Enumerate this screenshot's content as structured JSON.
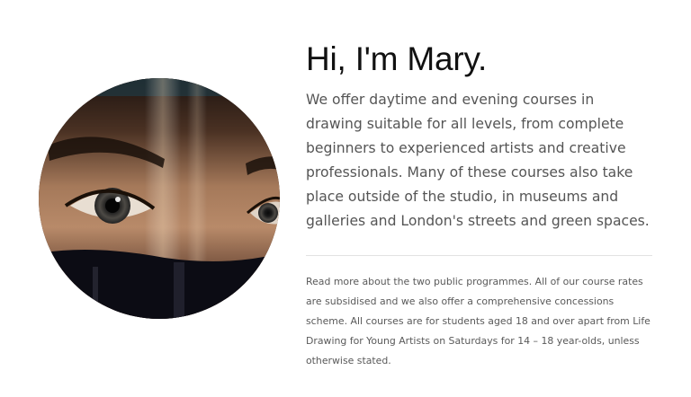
{
  "about": {
    "heading": "Hi, I'm Mary.",
    "lead": "We offer daytime and evening courses in drawing suitable for all levels, from complete beginners to experienced artists and creative professionals. Many of these courses also take place outside of the studio, in museums and galleries and London's streets and green spaces.",
    "note": "Read more about the two public programmes. All of our course rates are subsidised and we also offer a comprehensive concessions scheme. All courses are for students aged 18 and over apart from Life Drawing for Young Artists on Saturdays for 14 – 18 year-olds, unless otherwise stated."
  },
  "colors": {
    "heading": "#111111",
    "body_text": "#555555",
    "divider": "#e2e2e2"
  }
}
